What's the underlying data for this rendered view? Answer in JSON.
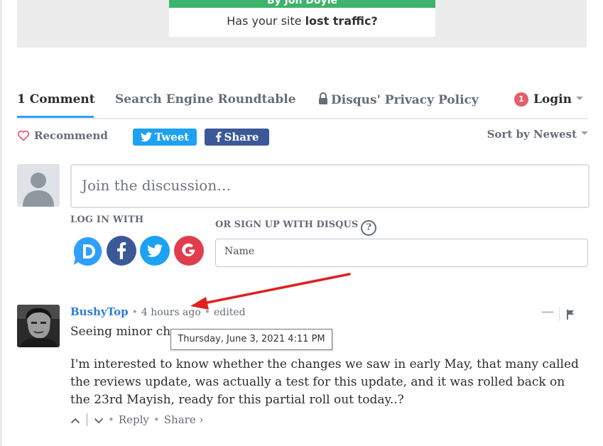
{
  "banner": {
    "top_text": "By Jon Doyle",
    "question_prefix": "Has your site ",
    "question_bold": "lost traffic?"
  },
  "nav": {
    "comments_tab": "1 Comment",
    "site_tab": "Search Engine Roundtable",
    "privacy_tab": "Disqus' Privacy Policy",
    "notification_count": "1",
    "login_label": "Login"
  },
  "actions": {
    "recommend_label": "Recommend",
    "tweet_label": "Tweet",
    "share_label": "Share",
    "sort_label": "Sort by Newest"
  },
  "compose": {
    "placeholder": "Join the discussion…",
    "login_with_label": "LOG IN WITH",
    "signup_label": "OR SIGN UP WITH DISQUS",
    "help_symbol": "?",
    "name_placeholder": "Name"
  },
  "social": [
    "disqus",
    "facebook",
    "twitter",
    "google"
  ],
  "comment": {
    "author": "BushyTop",
    "time": "4 hours ago",
    "edited": "edited",
    "first_line": "Seeing minor cha",
    "tooltip": "Thursday, June 3, 2021 4:11 PM",
    "body": "I'm interested to know whether the changes we saw in early May, that many called the reviews update, was actually a test for this update, and it was rolled back on the 23rd Mayish, ready for this partial roll out today..?",
    "collapse_symbol": "—",
    "reply_label": "Reply",
    "share_label": "Share ›"
  },
  "colors": {
    "accent_blue": "#2e9fff",
    "author_link": "#2e7cd6",
    "twitter": "#1da1f2",
    "facebook": "#3b5998",
    "google": "#e03e4d",
    "disqus": "#2e9fff",
    "notification": "#e55c6b",
    "annotation_arrow": "#e02020"
  }
}
